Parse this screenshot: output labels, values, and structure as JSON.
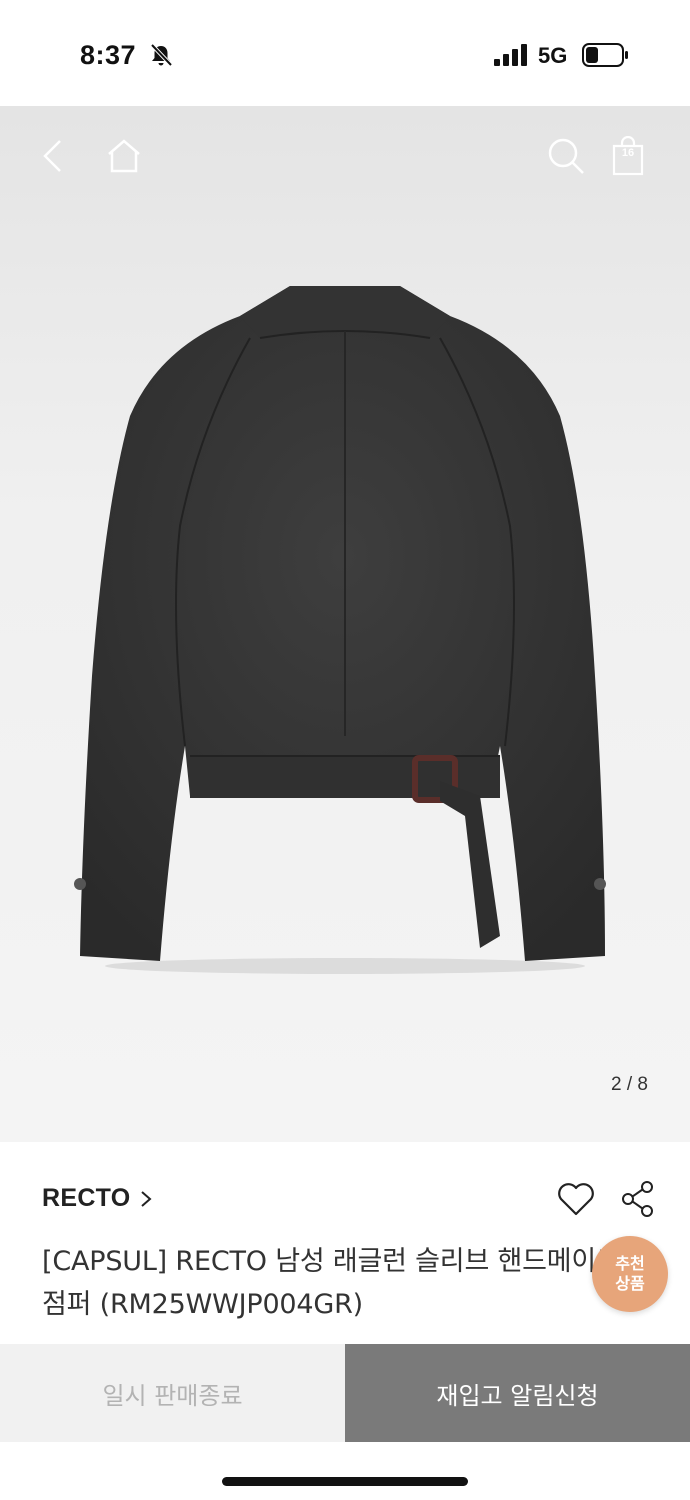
{
  "status": {
    "time": "8:37",
    "network": "5G"
  },
  "header": {
    "bag_count": "16"
  },
  "gallery": {
    "current": "2",
    "separator": "/",
    "total": "8"
  },
  "product": {
    "brand": "RECTO",
    "title": "[CAPSUL] RECTO 남성 래글런 슬리브 핸드메이드 점퍼 (RM25WWJP004GR)",
    "recommend_badge_line1": "추천",
    "recommend_badge_line2": "상품"
  },
  "actions": {
    "soldout_label": "일시 판매종료",
    "restock_label": "재입고 알림신청"
  },
  "colors": {
    "badge": "#e7a57a",
    "restock_button": "#7a7a7a",
    "soldout_button": "#f1f1f1"
  },
  "icons": [
    "bell-off-icon",
    "signal-icon",
    "battery-icon",
    "back-icon",
    "home-icon",
    "search-icon",
    "bag-icon",
    "chevron-right-icon",
    "heart-icon",
    "share-icon"
  ]
}
